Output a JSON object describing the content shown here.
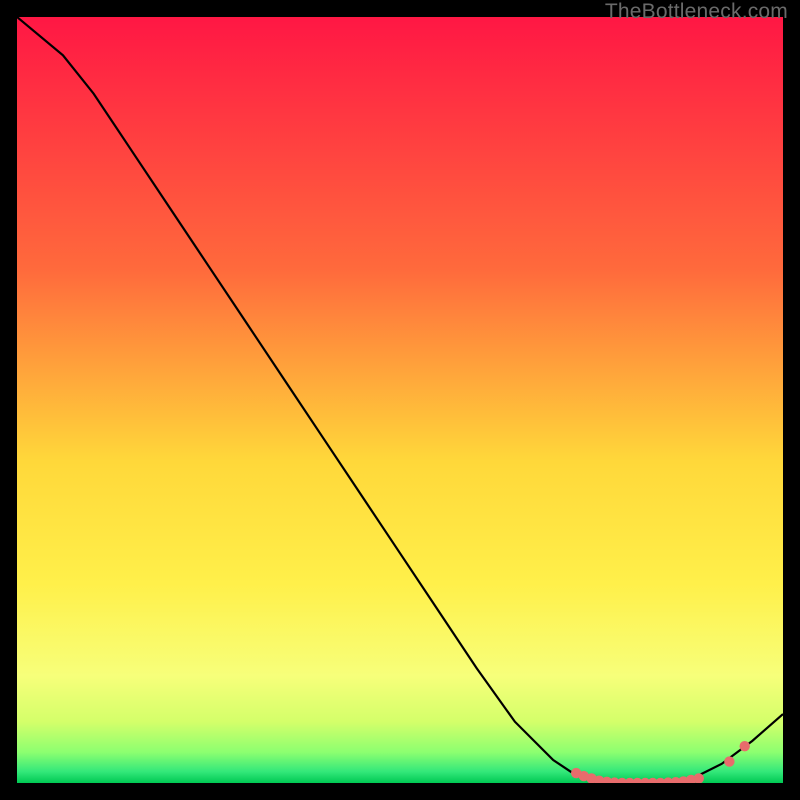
{
  "watermark": "TheBottleneck.com",
  "chart_data": {
    "type": "line",
    "title": "",
    "xlabel": "",
    "ylabel": "",
    "xlim": [
      0,
      100
    ],
    "ylim": [
      0,
      100
    ],
    "grid": false,
    "legend": false,
    "series": [
      {
        "name": "curve",
        "x": [
          0,
          6,
          10,
          15,
          20,
          25,
          30,
          35,
          40,
          45,
          50,
          55,
          60,
          65,
          70,
          73,
          76,
          80,
          84,
          88,
          92,
          96,
          100
        ],
        "y": [
          100,
          95,
          90,
          82.5,
          75,
          67.5,
          60,
          52.5,
          45,
          37.5,
          30,
          22.5,
          15,
          8,
          3,
          1,
          0,
          0,
          0,
          0.5,
          2.5,
          5.5,
          9
        ]
      },
      {
        "name": "dots",
        "x": [
          73,
          74,
          75,
          76,
          77,
          78,
          79,
          80,
          81,
          82,
          83,
          84,
          85,
          86,
          87,
          88,
          89,
          93,
          95
        ],
        "y": [
          1.3,
          0.9,
          0.6,
          0.3,
          0.15,
          0.05,
          0,
          0,
          0,
          0,
          0,
          0,
          0.05,
          0.1,
          0.2,
          0.4,
          0.6,
          2.8,
          4.8
        ]
      }
    ],
    "colors": {
      "curve": "#000000",
      "dots": "#e86c6c",
      "gradient_stops": [
        {
          "offset": 0.0,
          "color": "#ff1744"
        },
        {
          "offset": 0.33,
          "color": "#ff6a3c"
        },
        {
          "offset": 0.58,
          "color": "#ffd83a"
        },
        {
          "offset": 0.74,
          "color": "#fff04a"
        },
        {
          "offset": 0.86,
          "color": "#f7ff7a"
        },
        {
          "offset": 0.92,
          "color": "#d4ff6a"
        },
        {
          "offset": 0.96,
          "color": "#8cff70"
        },
        {
          "offset": 0.985,
          "color": "#34e87a"
        },
        {
          "offset": 1.0,
          "color": "#00c853"
        }
      ]
    }
  }
}
